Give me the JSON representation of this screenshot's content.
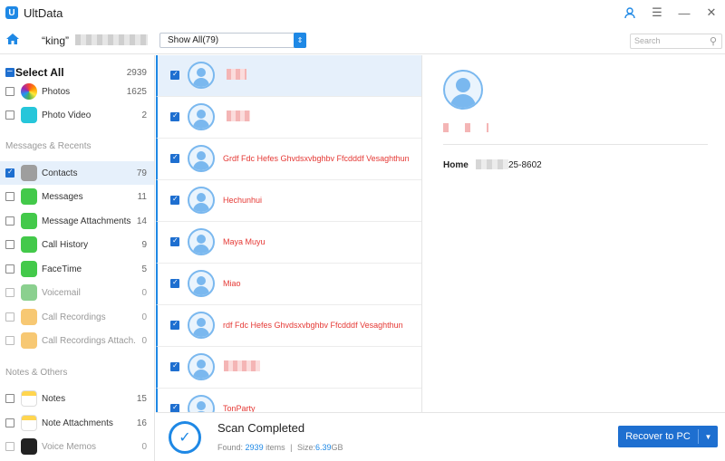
{
  "window": {
    "title": "UltData",
    "logo": "U"
  },
  "toolbar": {
    "device_prefix": "“king”",
    "filter": {
      "selected": "Show All(79)"
    },
    "search": {
      "placeholder": "Search"
    }
  },
  "sidebar": {
    "select_all": {
      "label": "Select All",
      "count": "2939"
    },
    "top_items": [
      {
        "label": "Photos",
        "count": "1625",
        "icon": "photos-icon",
        "checked": false
      },
      {
        "label": "Photo Video",
        "count": "2",
        "icon": "photo-video-icon",
        "checked": false
      }
    ],
    "messages_section": "Messages & Recents",
    "message_items": [
      {
        "label": "Contacts",
        "count": "79",
        "icon": "contacts-icon",
        "checked": true,
        "active": true
      },
      {
        "label": "Messages",
        "count": "11",
        "icon": "messages-icon"
      },
      {
        "label": "Message Attachments",
        "count": "14",
        "icon": "message-attachments-icon"
      },
      {
        "label": "Call History",
        "count": "9",
        "icon": "call-history-icon"
      },
      {
        "label": "FaceTime",
        "count": "5",
        "icon": "facetime-icon"
      },
      {
        "label": "Voicemail",
        "count": "0",
        "icon": "voicemail-icon",
        "disabled": true
      },
      {
        "label": "Call Recordings",
        "count": "0",
        "icon": "call-recordings-icon",
        "disabled": true
      },
      {
        "label": "Call Recordings Attach...",
        "count": "0",
        "icon": "call-recordings-attachments-icon",
        "disabled": true
      }
    ],
    "notes_section": "Notes & Others",
    "notes_items": [
      {
        "label": "Notes",
        "count": "15",
        "icon": "notes-icon"
      },
      {
        "label": "Note Attachments",
        "count": "16",
        "icon": "note-attachments-icon"
      },
      {
        "label": "Voice Memos",
        "count": "0",
        "icon": "voice-memos-icon",
        "disabled": true
      }
    ]
  },
  "contacts": [
    {
      "name": ""
    },
    {
      "name": ""
    },
    {
      "name": "Grdf Fdc Hefes Ghvdsxvbghbv Ffcdddf Vesaghthun"
    },
    {
      "name": "Hechunhui"
    },
    {
      "name": "Maya Muyu"
    },
    {
      "name": "Miao"
    },
    {
      "name": "rdf Fdc Hefes Ghvdsxvbghbv Ffcdddf Vesaghthun"
    },
    {
      "name": ""
    },
    {
      "name": "TonParty"
    }
  ],
  "detail": {
    "field_label": "Home",
    "field_value": "25-8602"
  },
  "footer": {
    "title": "Scan Completed",
    "found_label": "Found:",
    "found_count": "2939",
    "found_suffix": "items",
    "divider": "|",
    "size_label": "Size:",
    "size_value": "6.39",
    "size_unit": "GB",
    "recover_label": "Recover to PC"
  },
  "colors": {
    "accent": "#1e88e5",
    "contact_name": "#e53935",
    "active_row": "#e6f0fb"
  }
}
